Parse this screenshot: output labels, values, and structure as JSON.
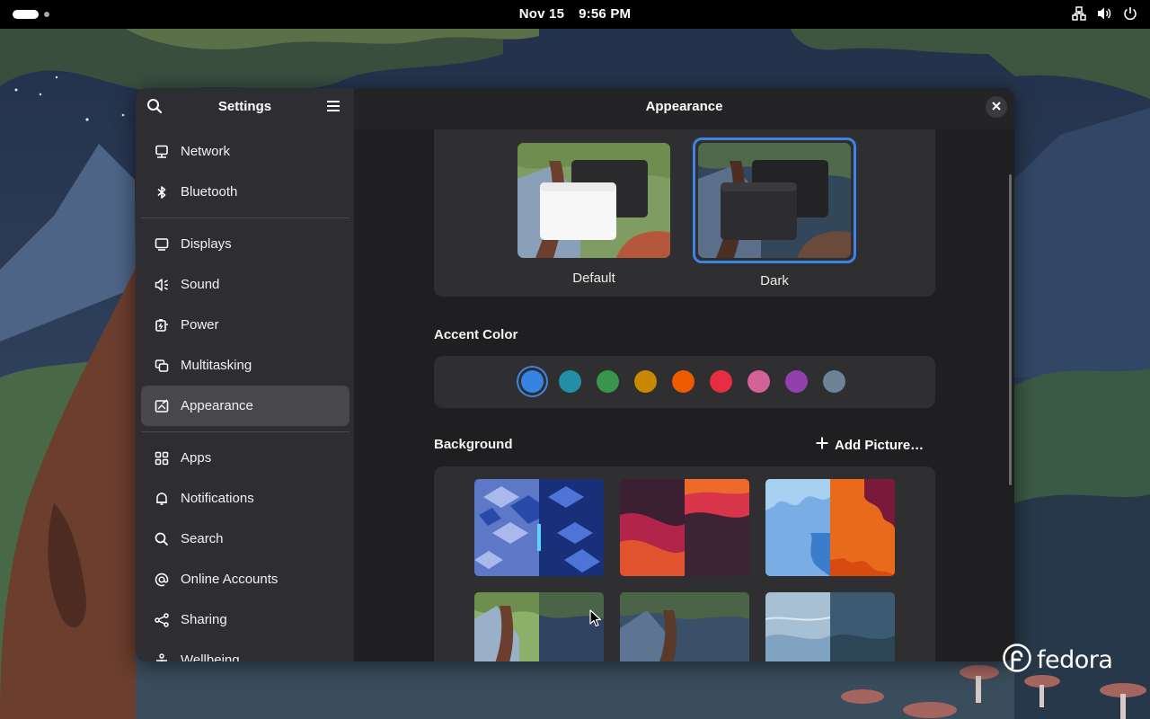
{
  "topbar": {
    "date": "Nov 15",
    "time": "9:56 PM",
    "tray_icons": [
      "network-wired-icon",
      "volume-icon",
      "power-icon"
    ]
  },
  "window": {
    "sidebar_title": "Settings",
    "main_title": "Appearance"
  },
  "sidebar": {
    "items": [
      {
        "label": "Network",
        "icon": "network-icon"
      },
      {
        "label": "Bluetooth",
        "icon": "bluetooth-icon"
      },
      {
        "label": "Displays",
        "icon": "display-icon"
      },
      {
        "label": "Sound",
        "icon": "speaker-icon"
      },
      {
        "label": "Power",
        "icon": "battery-icon"
      },
      {
        "label": "Multitasking",
        "icon": "multitasking-icon"
      },
      {
        "label": "Appearance",
        "icon": "appearance-icon",
        "selected": true
      },
      {
        "label": "Apps",
        "icon": "apps-grid-icon"
      },
      {
        "label": "Notifications",
        "icon": "bell-icon"
      },
      {
        "label": "Search",
        "icon": "search-icon"
      },
      {
        "label": "Online Accounts",
        "icon": "at-sign-icon"
      },
      {
        "label": "Sharing",
        "icon": "share-icon"
      },
      {
        "label": "Wellbeing",
        "icon": "wellbeing-icon"
      }
    ]
  },
  "style": {
    "options": [
      {
        "label": "Default",
        "selected": false
      },
      {
        "label": "Dark",
        "selected": true
      }
    ]
  },
  "accent": {
    "heading": "Accent Color",
    "colors": [
      "#3584e4",
      "#2190a4",
      "#3a944a",
      "#c88800",
      "#ed5b00",
      "#e62d42",
      "#d56199",
      "#9141ac",
      "#6f8396"
    ],
    "selected_index": 0
  },
  "background": {
    "heading": "Background",
    "add_label": "Add Picture…"
  },
  "brand": {
    "logo_text": "fedora"
  }
}
